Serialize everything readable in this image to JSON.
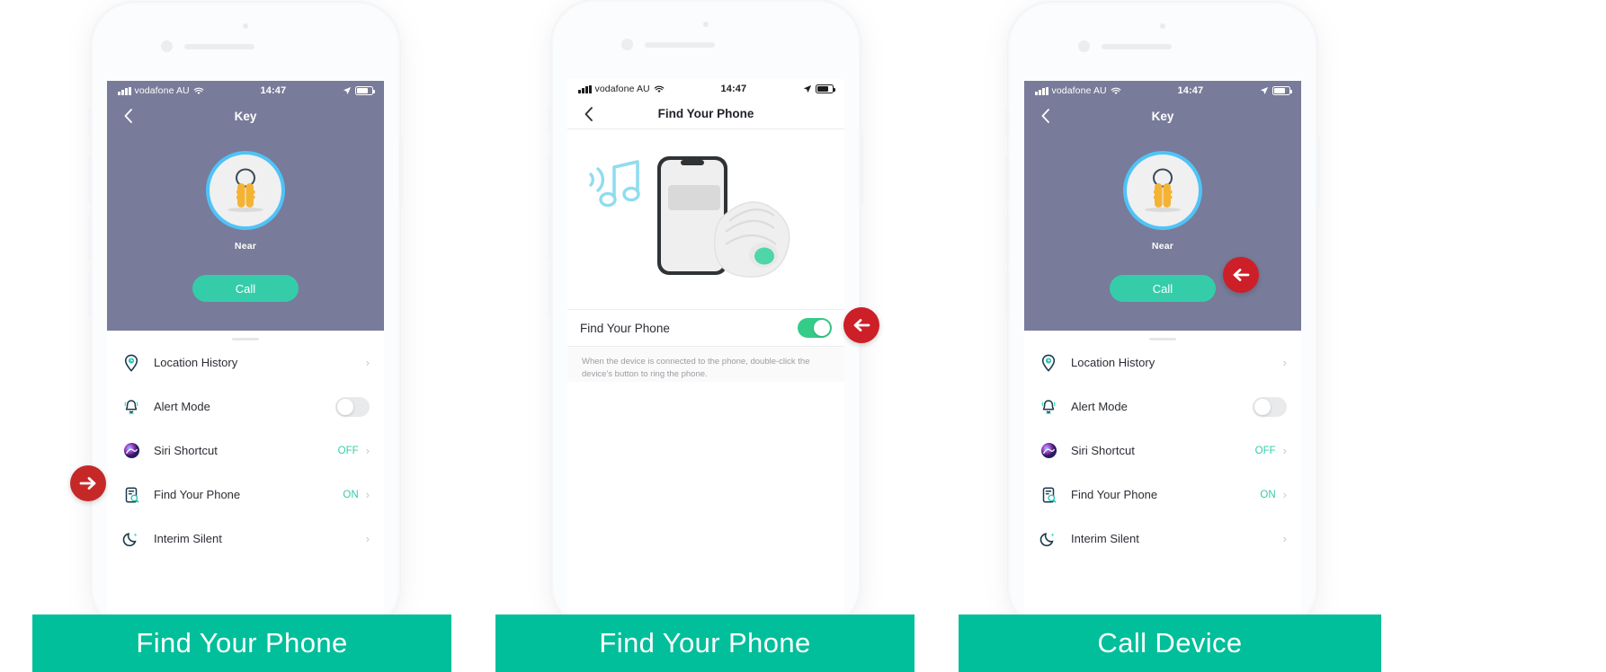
{
  "panels": [
    {
      "id": "panel-key-find-your-phone",
      "status_bar": {
        "carrier": "vodafone AU",
        "time": "14:47"
      },
      "nav": {
        "back_icon": "chevron-left-icon",
        "title": "Key"
      },
      "hero": {
        "device_icon": "keys-icon",
        "status": "Near",
        "call_label": "Call"
      },
      "list": [
        {
          "icon": "location-pin-icon",
          "label": "Location History",
          "value": "",
          "accessory": "chevron"
        },
        {
          "icon": "bell-alert-icon",
          "label": "Alert Mode",
          "value": "",
          "accessory": "toggle-off"
        },
        {
          "icon": "siri-icon",
          "label": "Siri Shortcut",
          "value": "OFF",
          "accessory": "chevron"
        },
        {
          "icon": "find-phone-icon",
          "label": "Find Your Phone",
          "value": "ON",
          "accessory": "chevron"
        },
        {
          "icon": "moon-icon",
          "label": "Interim Silent",
          "value": "",
          "accessory": "chevron"
        }
      ],
      "annotation": {
        "icon": "arrow-right-icon",
        "color": "#c62828"
      },
      "caption": "Find Your Phone"
    },
    {
      "id": "panel-find-your-phone-detail",
      "status_bar": {
        "carrier": "vodafone AU",
        "time": "14:47"
      },
      "nav": {
        "back_icon": "chevron-left-icon",
        "title": "Find Your Phone"
      },
      "illustration": {
        "music_icon": "music-note-icon",
        "phone_icon": "smartphone-icon",
        "tracker_icon": "tracker-tag-icon"
      },
      "toggle_row": {
        "label": "Find Your Phone",
        "state": "on"
      },
      "helper_text": "When the device is connected to the phone, double-click the device's button to ring the phone.",
      "annotation": {
        "icon": "arrow-left-icon",
        "color": "#cc1f27"
      },
      "caption": "Find Your Phone"
    },
    {
      "id": "panel-key-call-device",
      "status_bar": {
        "carrier": "vodafone AU",
        "time": "14:47"
      },
      "nav": {
        "back_icon": "chevron-left-icon",
        "title": "Key"
      },
      "hero": {
        "device_icon": "keys-icon",
        "status": "Near",
        "call_label": "Call"
      },
      "list": [
        {
          "icon": "location-pin-icon",
          "label": "Location History",
          "value": "",
          "accessory": "chevron"
        },
        {
          "icon": "bell-alert-icon",
          "label": "Alert Mode",
          "value": "",
          "accessory": "toggle-off"
        },
        {
          "icon": "siri-icon",
          "label": "Siri Shortcut",
          "value": "OFF",
          "accessory": "chevron"
        },
        {
          "icon": "find-phone-icon",
          "label": "Find Your Phone",
          "value": "ON",
          "accessory": "chevron"
        },
        {
          "icon": "moon-icon",
          "label": "Interim Silent",
          "value": "",
          "accessory": "chevron"
        }
      ],
      "annotation": {
        "icon": "arrow-left-icon",
        "color": "#cc1f27"
      },
      "caption": "Call Device"
    }
  ],
  "colors": {
    "hero_purple": "#787b99",
    "accent_green": "#35ccaa",
    "toggle_on_green": "#35cc8a",
    "caption_green": "#00bf9a",
    "ring_blue": "#4fc3f7",
    "annotation_red": "#c62828",
    "key_yellow": "#f5b335"
  }
}
